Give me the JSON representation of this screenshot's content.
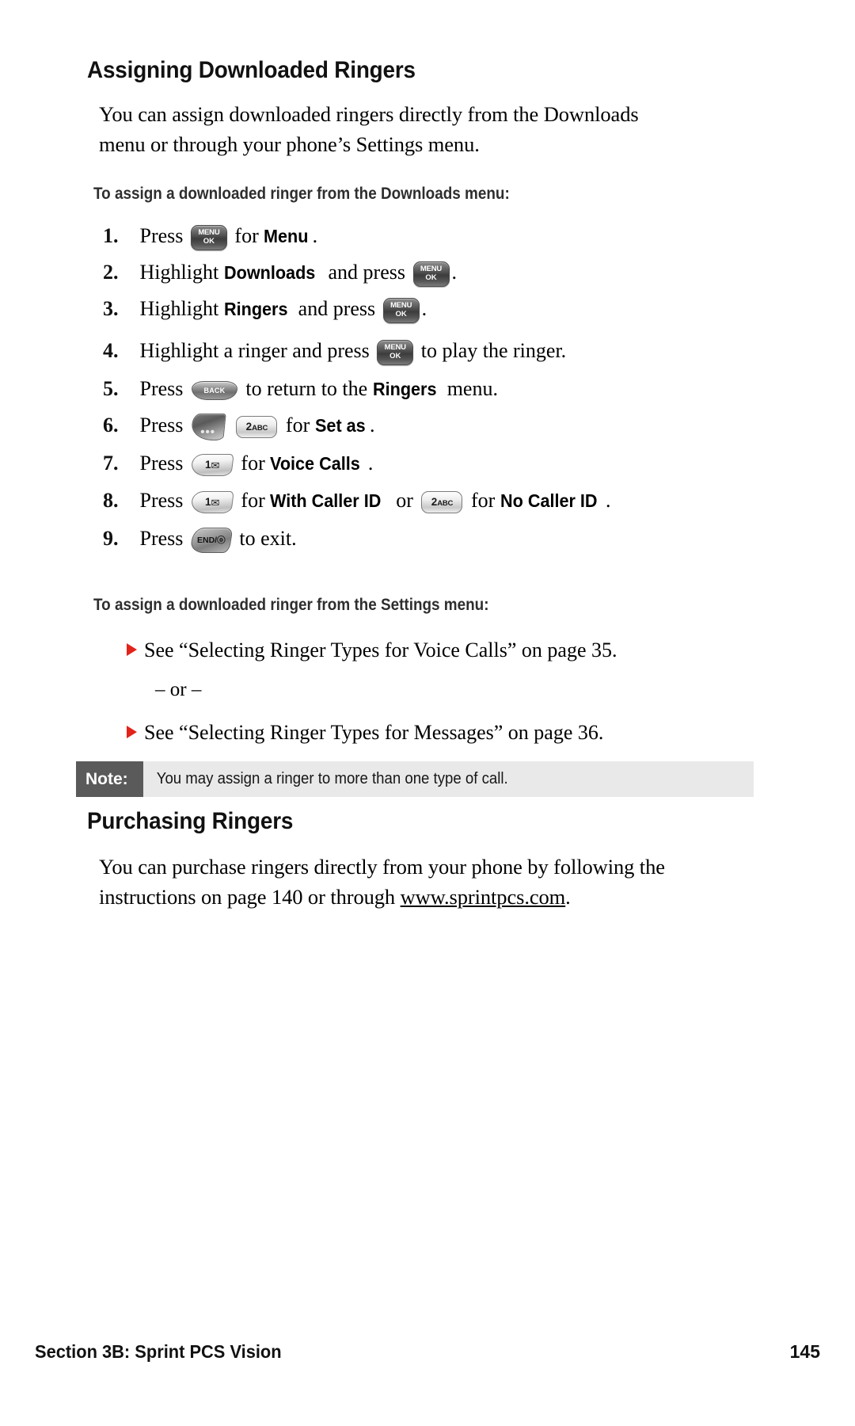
{
  "page": {
    "number": "145",
    "footer_section": "Section 3B: Sprint PCS Vision"
  },
  "sections": {
    "assigning": {
      "heading": "Assigning Downloaded Ringers",
      "intro_line1": "You can assign downloaded ringers directly from the Downloads",
      "intro_line2": "menu or through your phone’s Settings menu.",
      "subhead_downloads": "To assign a downloaded ringer from the Downloads menu:",
      "subhead_settings": "To assign a downloaded ringer from the Settings menu:"
    },
    "purchasing": {
      "heading": "Purchasing Ringers",
      "body_line1_a": "You can purchase ringers directly from your phone by following the",
      "body_line2_a": "instructions on page 140 or through ",
      "body_line2_link": "www.sprintpcs.com",
      "body_line2_b": "."
    }
  },
  "steps": [
    {
      "num": "1.",
      "pre": "Press",
      "key": "menu-ok",
      "mid": "for",
      "bold": "Menu",
      "post": "."
    },
    {
      "num": "2.",
      "pre": "Highlight",
      "bold": "Downloads",
      "mid": "and press",
      "key": "menu-ok",
      "post": "."
    },
    {
      "num": "3.",
      "pre": "Highlight",
      "bold": "Ringers",
      "mid": "and press",
      "key": "menu-ok",
      "post": "."
    },
    {
      "num": "4.",
      "pre": "Highlight a ringer and press",
      "key": "menu-ok",
      "post": "to play the ringer."
    },
    {
      "num": "5.",
      "pre": "Press",
      "key": "back",
      "mid": "to return to the",
      "bold": "Ringers",
      "post": "menu."
    },
    {
      "num": "6.",
      "pre": "Press",
      "key": "softkey-options",
      "key2": "two-abc",
      "mid": "for",
      "bold": "Set as",
      "post": "."
    },
    {
      "num": "7.",
      "pre": "Press",
      "key": "one-message",
      "mid": "for",
      "bold": "Voice Calls",
      "post": "."
    },
    {
      "num": "8.",
      "pre": "Press",
      "key": "one-message",
      "mid": "for",
      "bold": "With Caller ID",
      "conj": "or",
      "key2": "two-abc",
      "mid2": "for",
      "bold2": "No Caller ID",
      "post": "."
    },
    {
      "num": "9.",
      "pre": "Press",
      "key": "end-power",
      "post": "to exit."
    }
  ],
  "keys": {
    "menu_ok": {
      "line1": "MENU",
      "line2": "OK"
    },
    "back": {
      "label": "BACK"
    },
    "softkey_options": {
      "label": "•••"
    },
    "two_abc": {
      "digit": "2",
      "letters": "ABC"
    },
    "one_message": {
      "digit": "1",
      "glyph": "✉"
    },
    "end_power": {
      "label": "END/ⓞ"
    }
  },
  "cross_refs": [
    {
      "text": "See “Selecting Ringer Types for Voice Calls” on page 35."
    },
    {
      "text": "– or –"
    },
    {
      "text": "See “Selecting Ringer Types for Messages” on page 36."
    }
  ],
  "note": {
    "label": "Note:",
    "text": "You may assign a ringer to more than one type of call."
  },
  "colors": {
    "bullet_red": "#e2231a",
    "note_label_bg": "#5a5a5a",
    "note_bg": "#e9e9e9"
  }
}
